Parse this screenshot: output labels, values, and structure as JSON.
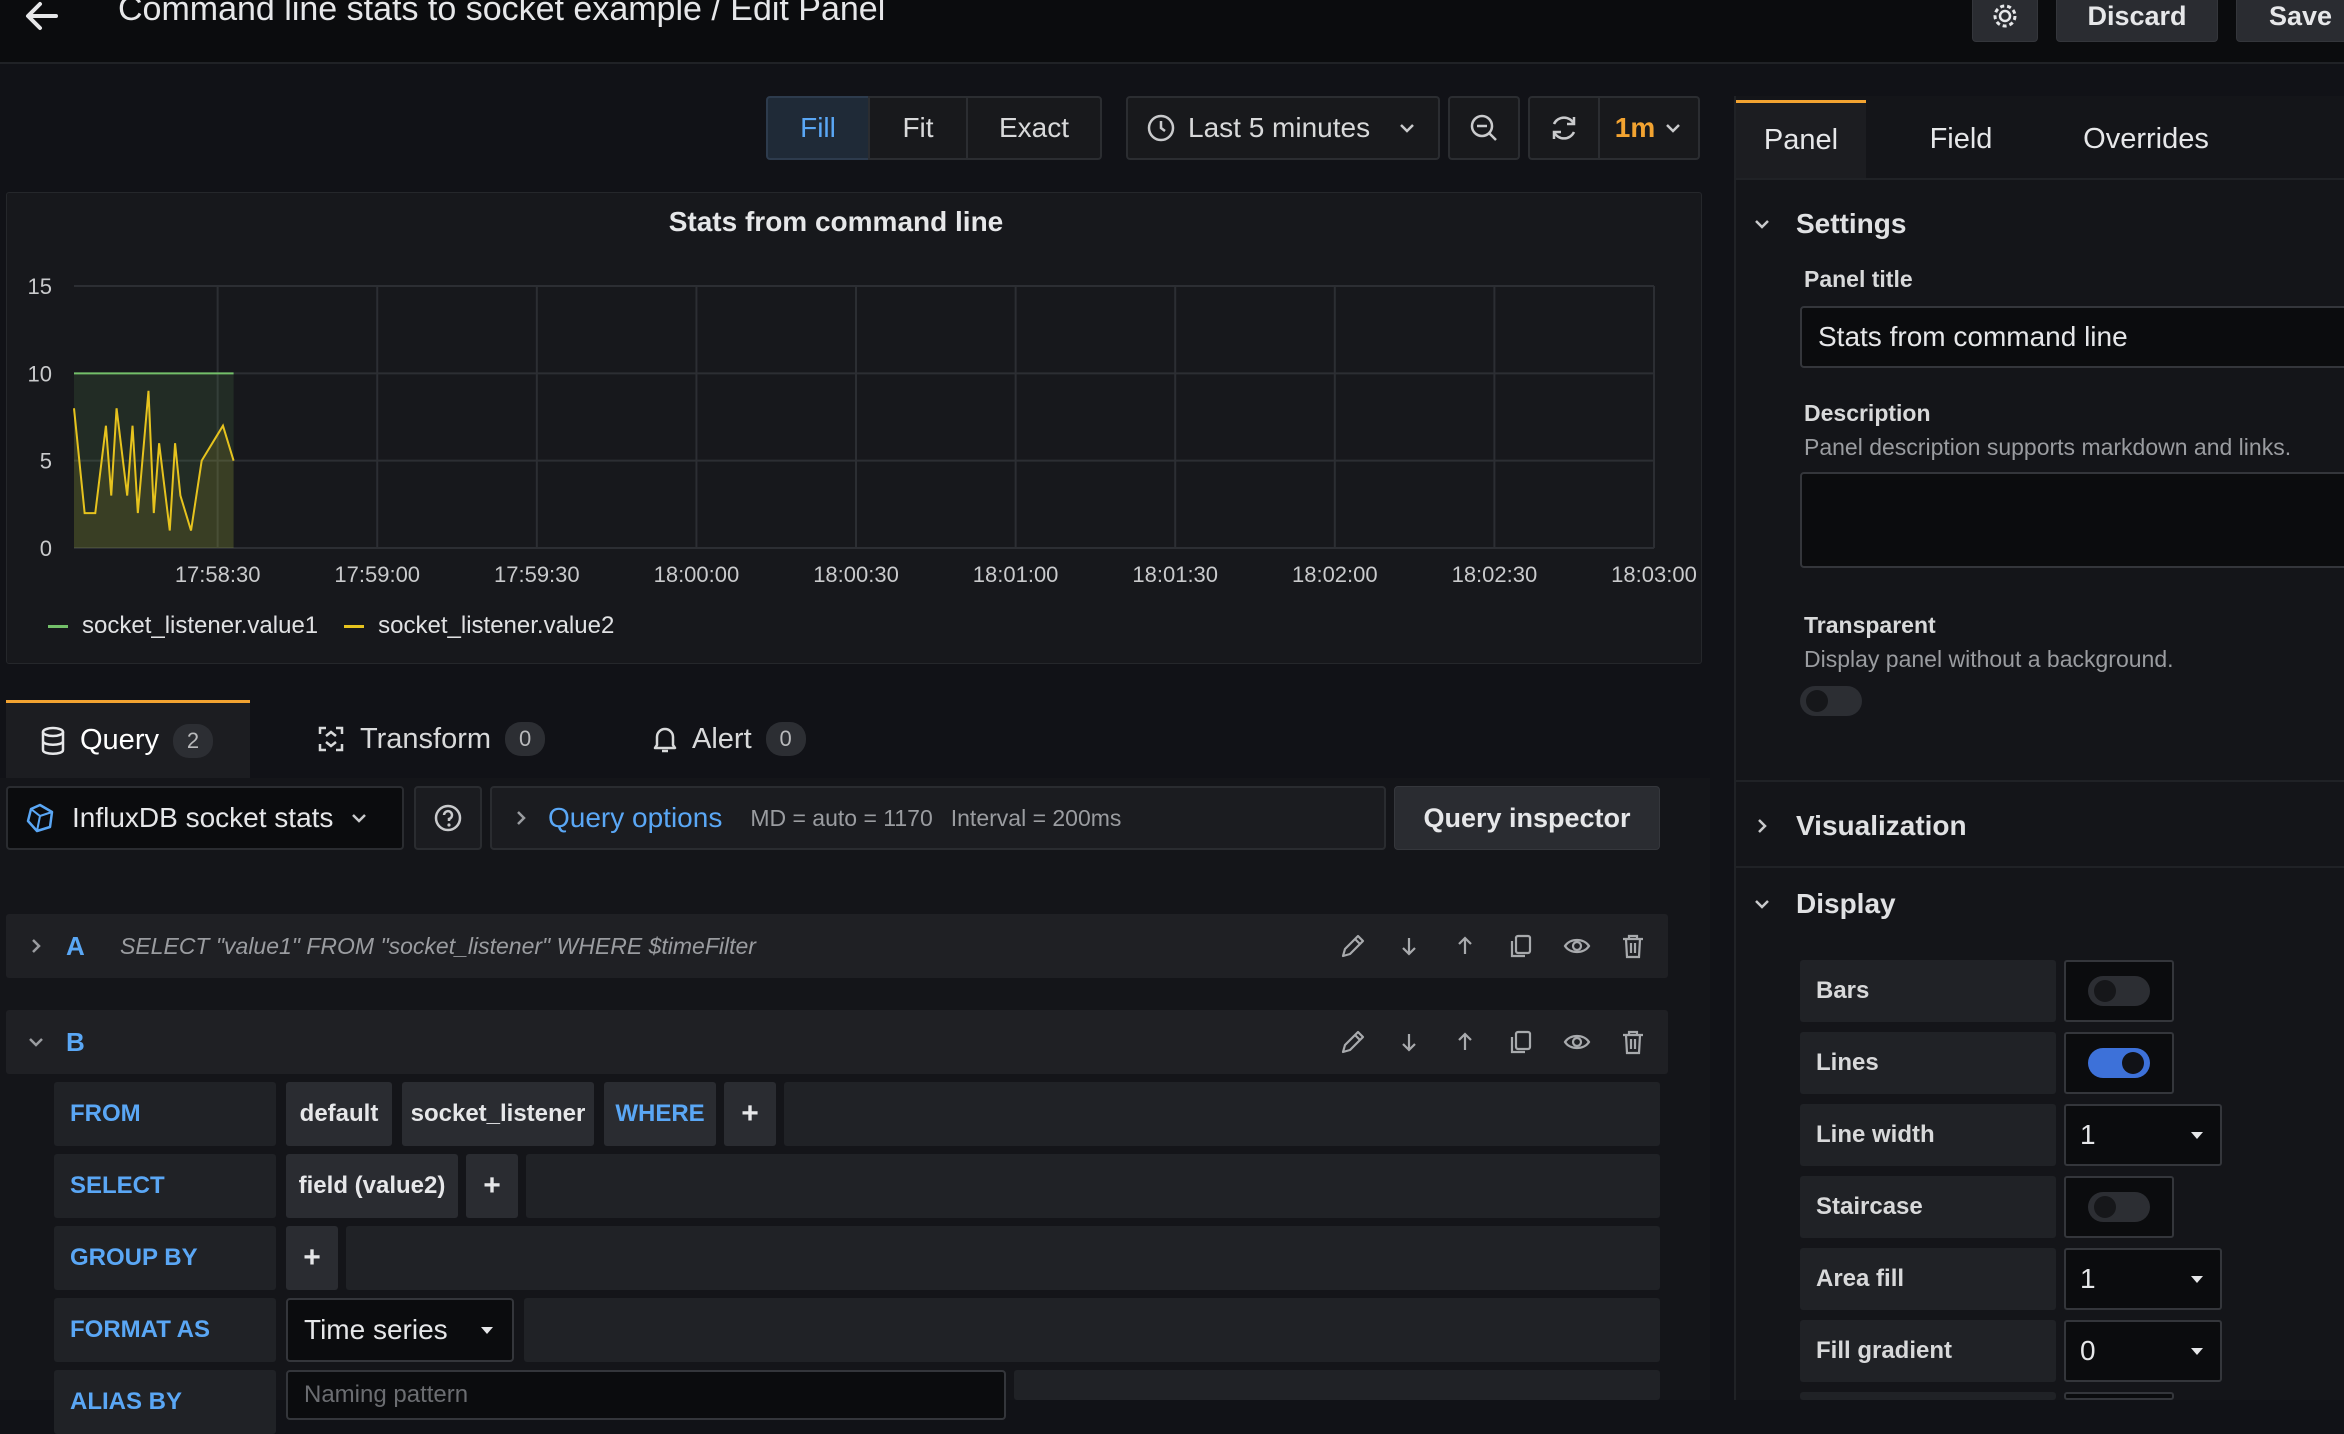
{
  "header": {
    "title": "Command line stats to socket example / Edit Panel",
    "discard_label": "Discard",
    "save_label": "Save"
  },
  "toolbar": {
    "fill_label": "Fill",
    "fit_label": "Fit",
    "exact_label": "Exact",
    "time_range": "Last 5 minutes",
    "refresh_interval": "1m"
  },
  "panel": {
    "title": "Stats from command line",
    "legend": [
      {
        "name": "socket_listener.value1",
        "color": "#73bf69"
      },
      {
        "name": "socket_listener.value2",
        "color": "#e6c31e"
      }
    ]
  },
  "chart_data": {
    "type": "line",
    "title": "Stats from command line",
    "x_ticks": [
      "17:58:30",
      "17:59:00",
      "17:59:30",
      "18:00:00",
      "18:00:30",
      "18:01:00",
      "18:01:30",
      "18:02:00",
      "18:02:30",
      "18:03:00"
    ],
    "y_ticks": [
      0,
      5,
      10,
      15
    ],
    "ylim": [
      0,
      15
    ],
    "xlim": [
      "17:58:03",
      "18:03:00"
    ],
    "grid": true,
    "legend_position": "bottom-left",
    "series": [
      {
        "name": "socket_listener.value1",
        "color": "#73bf69",
        "x": [
          "17:58:03",
          "17:58:33"
        ],
        "y": [
          10,
          10
        ]
      },
      {
        "name": "socket_listener.value2",
        "color": "#e6c31e",
        "x": [
          "17:58:03",
          "17:58:05",
          "17:58:07",
          "17:58:09",
          "17:58:10",
          "17:58:11",
          "17:58:13",
          "17:58:14",
          "17:58:15",
          "17:58:17",
          "17:58:18",
          "17:58:19",
          "17:58:21",
          "17:58:22",
          "17:58:23",
          "17:58:25",
          "17:58:26",
          "17:58:27",
          "17:58:29",
          "17:58:31",
          "17:58:33"
        ],
        "y": [
          8,
          2,
          2,
          7,
          3,
          8,
          3,
          7,
          2,
          9,
          2,
          6,
          1,
          6,
          3,
          1,
          3,
          5,
          6,
          7,
          5
        ]
      }
    ]
  },
  "query_tabs": [
    {
      "label": "Query",
      "count": "2"
    },
    {
      "label": "Transform",
      "count": "0"
    },
    {
      "label": "Alert",
      "count": "0"
    }
  ],
  "datasource": {
    "name": "InfluxDB socket stats"
  },
  "query_options": {
    "label": "Query options",
    "md": "MD = auto = 1170",
    "interval": "Interval = 200ms"
  },
  "query_inspector_label": "Query inspector",
  "queries": {
    "a": {
      "letter": "A",
      "text": "SELECT \"value1\" FROM \"socket_listener\" WHERE $timeFilter"
    },
    "b": {
      "letter": "B",
      "from_label": "FROM",
      "policy": "default",
      "measurement": "socket_listener",
      "where_label": "WHERE",
      "select_label": "SELECT",
      "select_field": "field (value2)",
      "group_by_label": "GROUP BY",
      "format_label": "FORMAT AS",
      "format_value": "Time series",
      "alias_label": "ALIAS BY",
      "alias_placeholder": "Naming pattern"
    }
  },
  "options": {
    "tabs": [
      "Panel",
      "Field",
      "Overrides"
    ],
    "settings": {
      "heading": "Settings",
      "title_label": "Panel title",
      "title_value": "Stats from command line",
      "description_label": "Description",
      "description_hint": "Panel description supports markdown and links.",
      "transparent_label": "Transparent",
      "transparent_hint": "Display panel without a background.",
      "transparent": false
    },
    "visualization_heading": "Visualization",
    "display": {
      "heading": "Display",
      "bars_label": "Bars",
      "bars": false,
      "lines_label": "Lines",
      "lines": true,
      "line_width_label": "Line width",
      "line_width": "1",
      "staircase_label": "Staircase",
      "staircase": false,
      "area_fill_label": "Area fill",
      "area_fill": "1",
      "fill_gradient_label": "Fill gradient",
      "fill_gradient": "0"
    }
  },
  "colors": {
    "accent": "#5aa7f5",
    "orange": "#f2a331",
    "toggle_on": "#3d71d9"
  }
}
